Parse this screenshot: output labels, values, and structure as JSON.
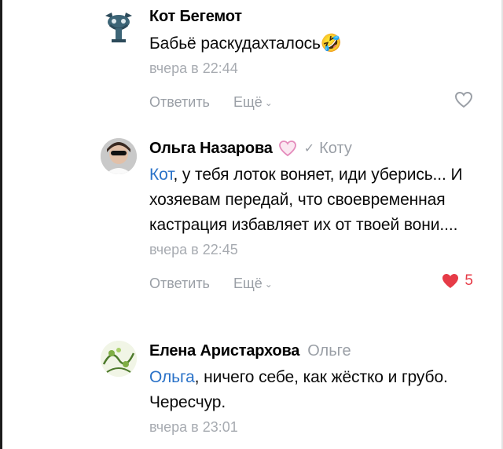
{
  "comments": [
    {
      "author": "Кот Бегемот",
      "reply_to": "",
      "mention": "",
      "text": "Бабьё раскудахталось",
      "emoji": "🤣",
      "time": "вчера в 22:44",
      "reply_label": "Ответить",
      "more_label": "Ещё",
      "likes": ""
    },
    {
      "author": "Ольга Назарова",
      "reply_to": "Коту",
      "mention": "Кот",
      "text": ", у тебя лоток воняет, иди уберись... И хозяевам передай, что своевременная кастрация избавляет их от твоей вони....",
      "time": "вчера в 22:45",
      "reply_label": "Ответить",
      "more_label": "Ещё",
      "likes": "5"
    },
    {
      "author": "Елена Аристархова",
      "reply_to": "Ольге",
      "mention": "Ольга",
      "text": ", ничего себе, как жёстко и грубо. Чересчур.",
      "time": "вчера в 23:01"
    }
  ],
  "colors": {
    "mention": "#2a72c8",
    "meta": "#9a9fa6",
    "like_active": "#e63b47"
  }
}
